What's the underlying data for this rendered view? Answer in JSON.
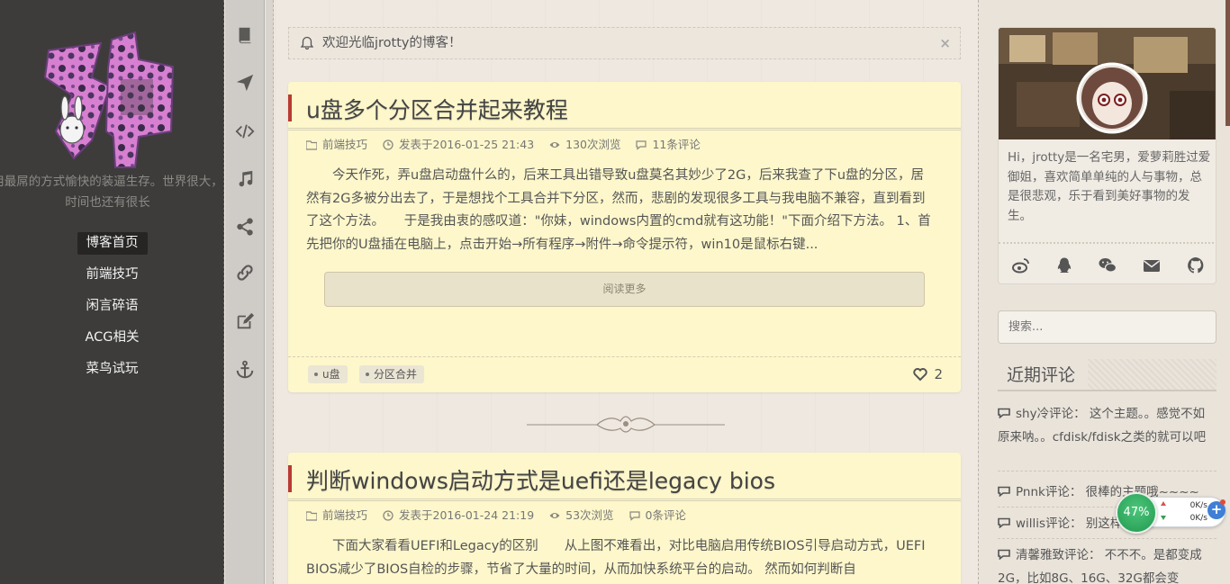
{
  "sidebar": {
    "motto": "用最屌的方式愉快的装逼生存。世界很大，时间也还有很长",
    "nav": [
      "博客首页",
      "前端技巧",
      "闲言碎语",
      "ACG相关",
      "菜鸟试玩"
    ],
    "active_index": 0
  },
  "iconbar": [
    "book-icon",
    "paper-plane-icon",
    "code-icon",
    "music-icon",
    "share-icon",
    "link-icon",
    "edit-icon",
    "anchor-icon"
  ],
  "notice": {
    "text": "欢迎光临jrotty的博客！",
    "close": "×"
  },
  "posts": [
    {
      "title": "u盘多个分区合并起来教程",
      "category": "前端技巧",
      "date": "发表于2016-01-25 21:43",
      "views": "130次浏览",
      "comments": "11条评论",
      "excerpt": "今天作死，弄u盘启动盘什么的，后来工具出错导致u盘莫名其妙少了2G，后来我查了下u盘的分区，居然有2G多被分出去了，于是想找个工具合并下分区，然而，悲剧的发现很多工具与我电脑不兼容，直到看到了这个方法。　　于是我由衷的感叹道：\"你妹，windows内置的cmd就有这功能！\"下面介绍下方法。 1、首先把你的U盘插在电脑上，点击开始→所有程序→附件→命令提示符，win10是鼠标右键...",
      "read_more": "阅读更多",
      "tags": [
        "u盘",
        "分区合并"
      ],
      "likes": "2"
    },
    {
      "title": "判断windows启动方式是uefi还是legacy bios",
      "category": "前端技巧",
      "date": "发表于2016-01-24 21:19",
      "views": "53次浏览",
      "comments": "0条评论",
      "excerpt": "下面大家看看UEFI和Legacy的区别　　从上图不难看出，对比电脑启用传统BIOS引导启动方式，UEFI BIOS减少了BIOS自检的步骤，节省了大量的时间，从而加快系统平台的启动。 然而如何判断自"
    }
  ],
  "profile": {
    "bio": "Hi，jrotty是一名宅男，爱萝莉胜过爱御姐，喜欢简单单纯的人与事物，总是很悲观，乐于看到美好事物的发生。",
    "social": [
      "weibo-icon",
      "qq-icon",
      "wechat-icon",
      "mail-icon",
      "github-icon"
    ]
  },
  "search": {
    "placeholder": "搜索..."
  },
  "recent": {
    "title": "近期评论",
    "comments": [
      "shy冷评论： 这个主题。。感觉不如原来呐。。cfdisk/fdisk之类的就可以吧",
      "Pnnk评论： 很棒的主题哦~~~~",
      "willis评论： 别这样",
      "清馨雅致评论： 不不不。是都变成2G，比如8G、16G、32G都会变"
    ]
  },
  "net": {
    "percent": "47%",
    "up": "0K/s",
    "down": "0K/s",
    "plus": "+"
  },
  "colors": {
    "accent": "#b93a33",
    "sidebar": "#3d3c3b",
    "card": "#fdf7cb"
  }
}
